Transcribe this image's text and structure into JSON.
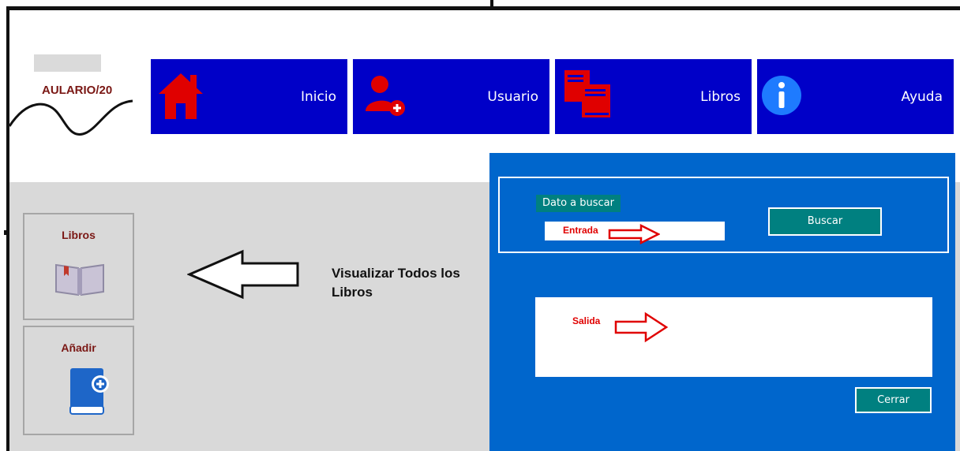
{
  "logo": {
    "text": "AULARIO/20"
  },
  "nav": [
    {
      "label": "Inicio",
      "icon": "home-icon"
    },
    {
      "label": "Usuario",
      "icon": "add-user-icon"
    },
    {
      "label": "Libros",
      "icon": "books-icon"
    },
    {
      "label": "Ayuda",
      "icon": "info-icon"
    }
  ],
  "sidebar": {
    "libros": {
      "title": "Libros",
      "icon": "open-book-icon"
    },
    "anadir": {
      "title": "Añadir",
      "icon": "add-book-icon"
    }
  },
  "annotation": {
    "text": "Visualizar Todos los Libros"
  },
  "search": {
    "dato_label": "Dato a buscar",
    "entrada_label": "Entrada",
    "buscar_label": "Buscar",
    "salida_label": "Salida",
    "cerrar_label": "Cerrar"
  },
  "colors": {
    "nav_blue": "#0000c8",
    "panel_blue": "#0066cc",
    "teal": "#008080",
    "icon_red": "#e00000",
    "label_red": "#7a1714",
    "gray_bg": "#d9d9d9"
  }
}
